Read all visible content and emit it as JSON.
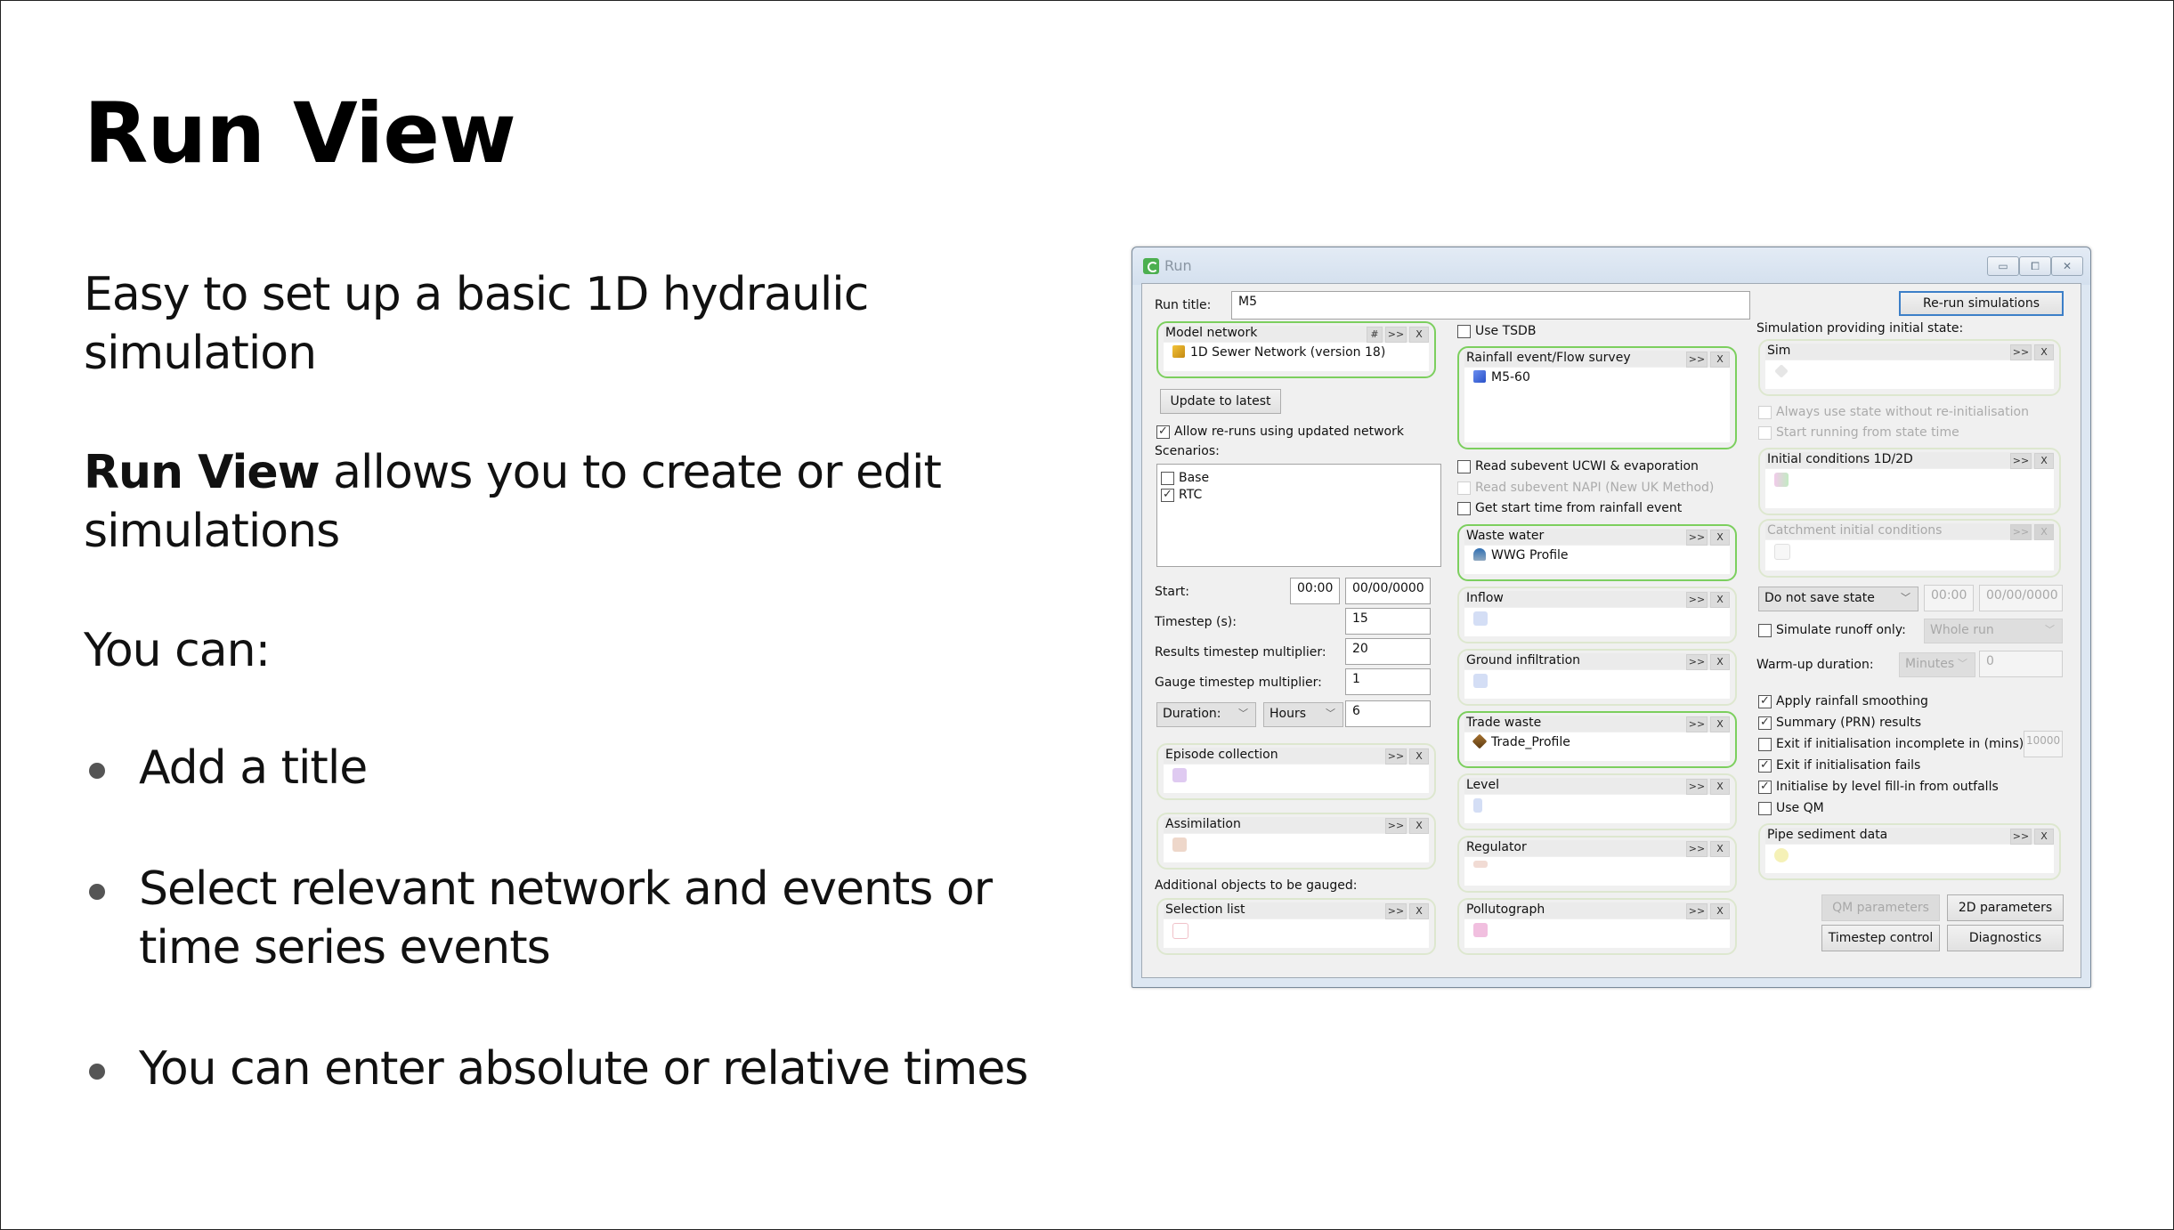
{
  "slide": {
    "title": "Run View",
    "intro": "Easy to set up a basic 1D hydraulic simulation",
    "desc_bold": "Run View",
    "desc_rest": " allows you to create or edit simulations",
    "you_can": "You can:",
    "bullets": [
      "Add a title",
      "Select relevant network and events or time series events",
      "You can enter absolute or relative times"
    ]
  },
  "dialog": {
    "title": "Run",
    "window_buttons": {
      "minimize": "▭",
      "maximize": "⧠",
      "close": "✕"
    },
    "run_title_label": "Run title:",
    "run_title_value": "M5",
    "rerun_button": "Re-run simulations",
    "model_network": {
      "title": "Model network",
      "hash": "#",
      "more": ">>",
      "clear": "X",
      "item": "1D Sewer Network (version 18)",
      "icon": "network-icon"
    },
    "update_button": "Update to latest",
    "allow_reruns": {
      "label": "Allow re-runs using updated network",
      "checked": true
    },
    "scenarios_label": "Scenarios:",
    "scenarios": [
      {
        "label": "Base",
        "checked": false
      },
      {
        "label": "RTC",
        "checked": true
      }
    ],
    "start_label": "Start:",
    "start_time": "00:00",
    "start_date": "00/00/0000",
    "timestep_label": "Timestep (s):",
    "timestep_value": "15",
    "results_mult_label": "Results timestep multiplier:",
    "results_mult_value": "20",
    "gauge_mult_label": "Gauge timestep multiplier:",
    "gauge_mult_value": "1",
    "duration_select": "Duration:",
    "duration_unit": "Hours",
    "duration_value": "6",
    "episode_collection": {
      "title": "Episode collection",
      "more": ">>",
      "clear": "X"
    },
    "assimilation": {
      "title": "Assimilation",
      "more": ">>",
      "clear": "X"
    },
    "additional_gauged_label": "Additional objects to be gauged:",
    "selection_list": {
      "title": "Selection list",
      "more": ">>",
      "clear": "X"
    },
    "use_tsdb": {
      "label": "Use TSDB",
      "checked": false
    },
    "rainfall": {
      "title": "Rainfall event/Flow survey",
      "more": ">>",
      "clear": "X",
      "item": "M5-60",
      "icon": "rainfall-event-icon"
    },
    "read_ucwi": {
      "label": "Read subevent UCWI & evaporation",
      "checked": false
    },
    "read_napi": {
      "label": "Read subevent NAPI (New UK Method)",
      "checked": false,
      "disabled": true
    },
    "start_from_rain": {
      "label": "Get start time from rainfall event",
      "checked": false
    },
    "waste_water": {
      "title": "Waste water",
      "more": ">>",
      "clear": "X",
      "item": "WWG Profile",
      "icon": "waste-water-icon"
    },
    "inflow": {
      "title": "Inflow",
      "more": ">>",
      "clear": "X"
    },
    "ground_infiltration": {
      "title": "Ground infiltration",
      "more": ">>",
      "clear": "X"
    },
    "trade_waste": {
      "title": "Trade waste",
      "more": ">>",
      "clear": "X",
      "item": "Trade_Profile",
      "icon": "trade-waste-icon"
    },
    "level": {
      "title": "Level",
      "more": ">>",
      "clear": "X"
    },
    "regulator": {
      "title": "Regulator",
      "more": ">>",
      "clear": "X"
    },
    "pollutograph": {
      "title": "Pollutograph",
      "more": ">>",
      "clear": "X"
    },
    "sim_state_label": "Simulation providing initial state:",
    "sim": {
      "title": "Sim",
      "more": ">>",
      "clear": "X"
    },
    "always_use_state": {
      "label": "Always use state without re-initialisation",
      "checked": false,
      "disabled": true
    },
    "start_from_state": {
      "label": "Start running from state time",
      "checked": false,
      "disabled": true
    },
    "initial_conditions": {
      "title": "Initial conditions 1D/2D",
      "more": ">>",
      "clear": "X"
    },
    "catchment_ic": {
      "title": "Catchment initial conditions",
      "more": ">>",
      "clear": "X",
      "disabled": true
    },
    "save_state_select": "Do not save state",
    "save_time": "00:00",
    "save_date": "00/00/0000",
    "simulate_runoff": {
      "label": "Simulate runoff only:",
      "checked": false
    },
    "runoff_select": "Whole run",
    "warmup_label": "Warm-up duration:",
    "warmup_unit": "Minutes",
    "warmup_value": "0",
    "options": [
      {
        "label": "Apply rainfall smoothing",
        "checked": true
      },
      {
        "label": "Summary (PRN) results",
        "checked": true
      },
      {
        "label": "Exit if initialisation incomplete in (mins):",
        "checked": false
      },
      {
        "label": "Exit if initialisation fails",
        "checked": true
      },
      {
        "label": "Initialise by level fill-in from outfalls",
        "checked": true
      },
      {
        "label": "Use QM",
        "checked": false
      }
    ],
    "init_incomplete_value": "10000",
    "pipe_sediment": {
      "title": "Pipe sediment data",
      "more": ">>",
      "clear": "X"
    },
    "qm_params_button": "QM parameters",
    "params_2d_button": "2D parameters",
    "timestep_control_button": "Timestep control",
    "diagnostics_button": "Diagnostics",
    "colors": {
      "active_group_border": "#7ccf5e",
      "focus_button_border": "#3c7fc8"
    }
  }
}
